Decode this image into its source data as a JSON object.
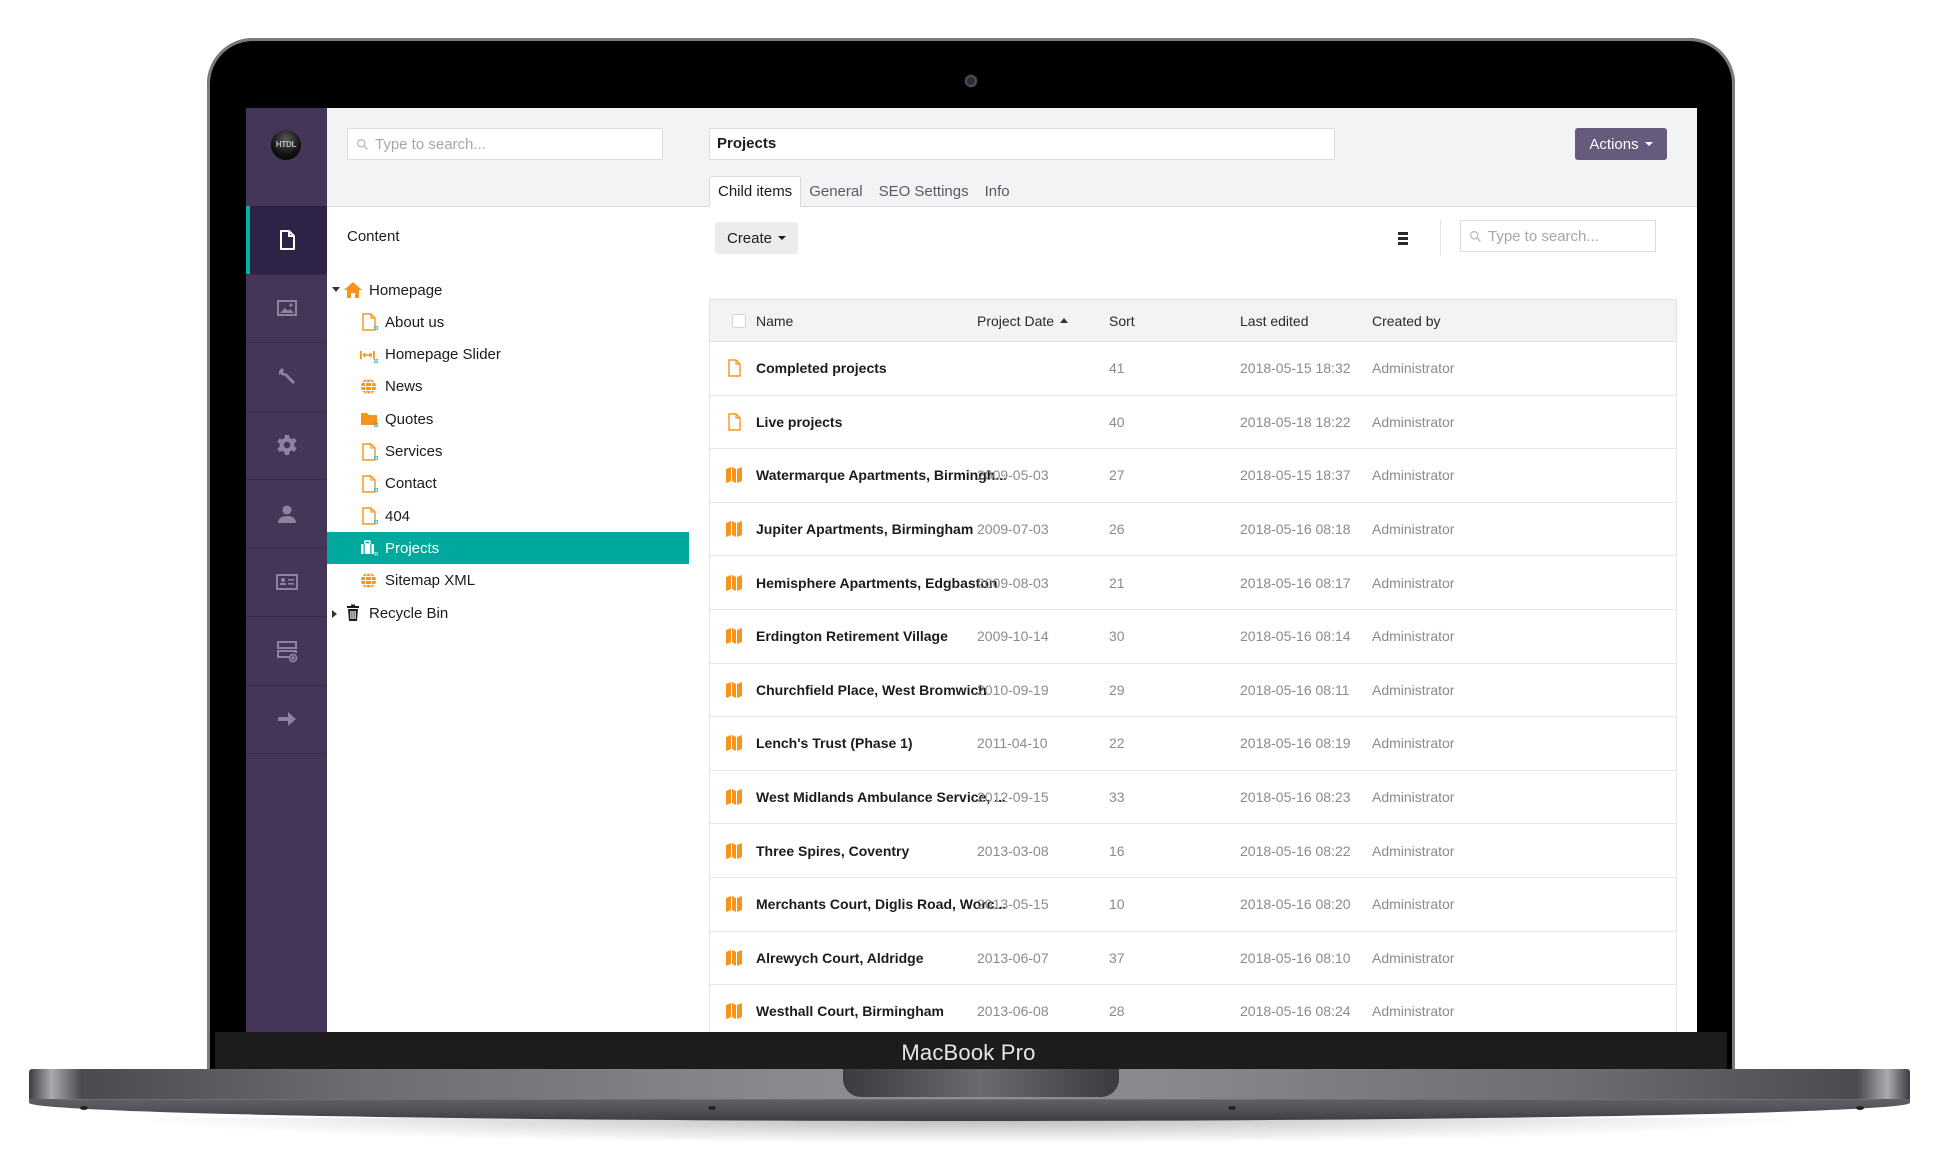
{
  "device": {
    "label": "MacBook Pro"
  },
  "app": {
    "logo_text": "HTDL"
  },
  "sidebar": {
    "items": [
      {
        "name": "content",
        "icon": "document-icon",
        "active": true
      },
      {
        "name": "media",
        "icon": "image-icon",
        "active": false
      },
      {
        "name": "settings-tools",
        "icon": "wrench-icon",
        "active": false
      },
      {
        "name": "settings",
        "icon": "gear-icon",
        "active": false
      },
      {
        "name": "users",
        "icon": "user-icon",
        "active": false
      },
      {
        "name": "members",
        "icon": "id-card-icon",
        "active": false
      },
      {
        "name": "forms",
        "icon": "form-add-icon",
        "active": false
      },
      {
        "name": "redirect",
        "icon": "arrow-right-icon",
        "active": false
      }
    ]
  },
  "tree": {
    "search_placeholder": "Type to search...",
    "section_title": "Content",
    "items": [
      {
        "label": "Homepage",
        "icon": "home-icon",
        "level": 0,
        "expander": "expanded",
        "selected": false
      },
      {
        "label": "About us",
        "icon": "page-icon",
        "level": 1,
        "selected": false
      },
      {
        "label": "Homepage Slider",
        "icon": "slider-icon",
        "level": 1,
        "selected": false
      },
      {
        "label": "News",
        "icon": "globe-icon",
        "level": 1,
        "selected": false
      },
      {
        "label": "Quotes",
        "icon": "folder-icon",
        "level": 1,
        "selected": false
      },
      {
        "label": "Services",
        "icon": "page-icon",
        "level": 1,
        "selected": false
      },
      {
        "label": "Contact",
        "icon": "page-icon",
        "level": 1,
        "selected": false
      },
      {
        "label": "404",
        "icon": "page-icon",
        "level": 1,
        "selected": false
      },
      {
        "label": "Projects",
        "icon": "briefcase-icon",
        "level": 1,
        "selected": true
      },
      {
        "label": "Sitemap XML",
        "icon": "globe-icon",
        "level": 1,
        "selected": false
      },
      {
        "label": "Recycle Bin",
        "icon": "trash-icon",
        "level": 0,
        "expander": "collapsed",
        "selected": false
      }
    ]
  },
  "editor": {
    "title": "Projects",
    "actions_label": "Actions",
    "tabs": [
      {
        "label": "Child items",
        "active": true
      },
      {
        "label": "General",
        "active": false
      },
      {
        "label": "SEO Settings",
        "active": false
      },
      {
        "label": "Info",
        "active": false
      }
    ],
    "create_label": "Create",
    "search_placeholder": "Type to search..."
  },
  "table": {
    "columns": [
      "Name",
      "Project Date",
      "Sort",
      "Last edited",
      "Created by"
    ],
    "sorted_column": "Project Date",
    "sort_direction": "ascending",
    "rows": [
      {
        "icon": "page-icon",
        "name": "Completed projects",
        "project_date": "",
        "sort": "41",
        "last_edited": "2018-05-15 18:32",
        "created_by": "Administrator"
      },
      {
        "icon": "page-icon",
        "name": "Live projects",
        "project_date": "",
        "sort": "40",
        "last_edited": "2018-05-18 18:22",
        "created_by": "Administrator"
      },
      {
        "icon": "map-icon",
        "name": "Watermarque Apartments, Birmingh...",
        "project_date": "2009-05-03",
        "sort": "27",
        "last_edited": "2018-05-15 18:37",
        "created_by": "Administrator"
      },
      {
        "icon": "map-icon",
        "name": "Jupiter Apartments, Birmingham",
        "project_date": "2009-07-03",
        "sort": "26",
        "last_edited": "2018-05-16 08:18",
        "created_by": "Administrator"
      },
      {
        "icon": "map-icon",
        "name": "Hemisphere Apartments, Edgbaston",
        "project_date": "2009-08-03",
        "sort": "21",
        "last_edited": "2018-05-16 08:17",
        "created_by": "Administrator"
      },
      {
        "icon": "map-icon",
        "name": "Erdington Retirement Village",
        "project_date": "2009-10-14",
        "sort": "30",
        "last_edited": "2018-05-16 08:14",
        "created_by": "Administrator"
      },
      {
        "icon": "map-icon",
        "name": "Churchfield Place, West Bromwich",
        "project_date": "2010-09-19",
        "sort": "29",
        "last_edited": "2018-05-16 08:11",
        "created_by": "Administrator"
      },
      {
        "icon": "map-icon",
        "name": "Lench's Trust (Phase 1)",
        "project_date": "2011-04-10",
        "sort": "22",
        "last_edited": "2018-05-16 08:19",
        "created_by": "Administrator"
      },
      {
        "icon": "map-icon",
        "name": "West Midlands Ambulance Service, ...",
        "project_date": "2012-09-15",
        "sort": "33",
        "last_edited": "2018-05-16 08:23",
        "created_by": "Administrator"
      },
      {
        "icon": "map-icon",
        "name": "Three Spires, Coventry",
        "project_date": "2013-03-08",
        "sort": "16",
        "last_edited": "2018-05-16 08:22",
        "created_by": "Administrator"
      },
      {
        "icon": "map-icon",
        "name": "Merchants Court, Diglis Road, Worc...",
        "project_date": "2013-05-15",
        "sort": "10",
        "last_edited": "2018-05-16 08:20",
        "created_by": "Administrator"
      },
      {
        "icon": "map-icon",
        "name": "Alrewych Court, Aldridge",
        "project_date": "2013-06-07",
        "sort": "37",
        "last_edited": "2018-05-16 08:10",
        "created_by": "Administrator"
      },
      {
        "icon": "map-icon",
        "name": "Westhall Court, Birmingham",
        "project_date": "2013-06-08",
        "sort": "28",
        "last_edited": "2018-05-16 08:24",
        "created_by": "Administrator"
      }
    ]
  },
  "colors": {
    "sidebar_bg": "#433659",
    "sidebar_active_bg": "#2e2247",
    "accent_teal": "#00a99d",
    "actions_button": "#665a7d",
    "icon_orange": "#f7941d"
  }
}
